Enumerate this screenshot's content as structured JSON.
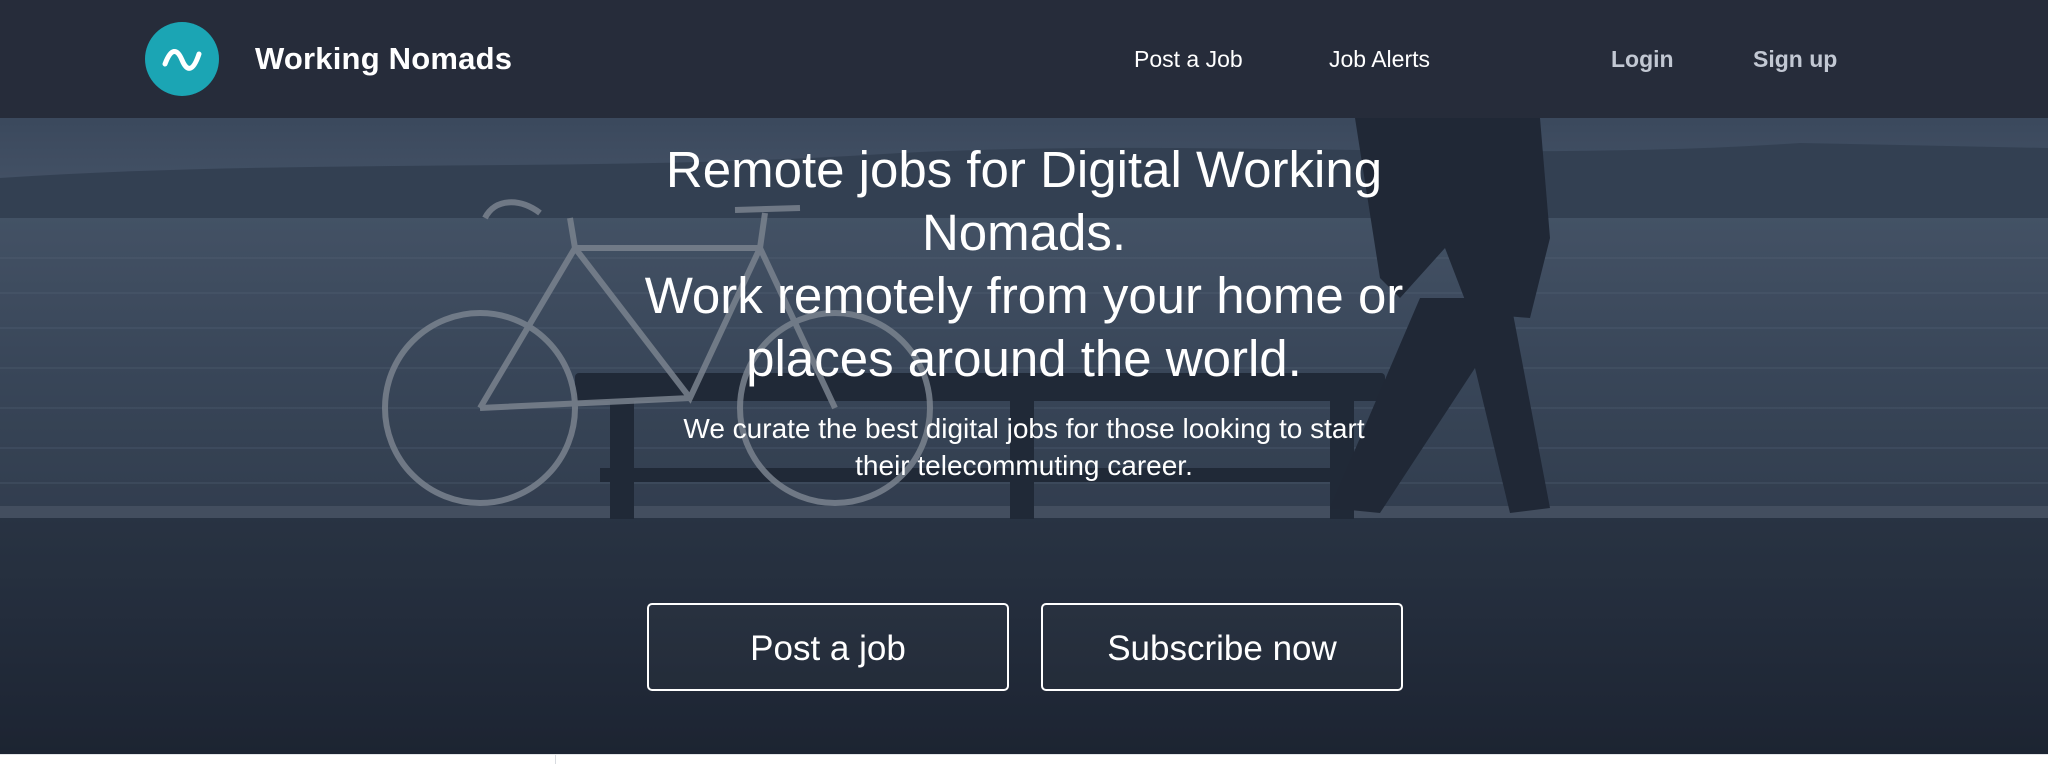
{
  "brand": {
    "name": "Working Nomads",
    "accent_color": "#1ba5b4",
    "logo_icon": "wave-icon"
  },
  "nav": {
    "post_job": "Post a Job",
    "job_alerts": "Job Alerts",
    "login": "Login",
    "signup": "Sign up"
  },
  "hero": {
    "title_line1": "Remote jobs for Digital Working",
    "title_line2": "Nomads.",
    "title_line3": "Work remotely from your home or",
    "title_line4": "places around the world.",
    "subtitle_line1": "We curate the best digital jobs for those looking to start",
    "subtitle_line2": "their telecommuting career.",
    "post_job_button": "Post a job",
    "subscribe_button": "Subscribe now"
  },
  "colors": {
    "navbar_bg": "#262c3a",
    "hero_overlay": "#2d3849"
  }
}
